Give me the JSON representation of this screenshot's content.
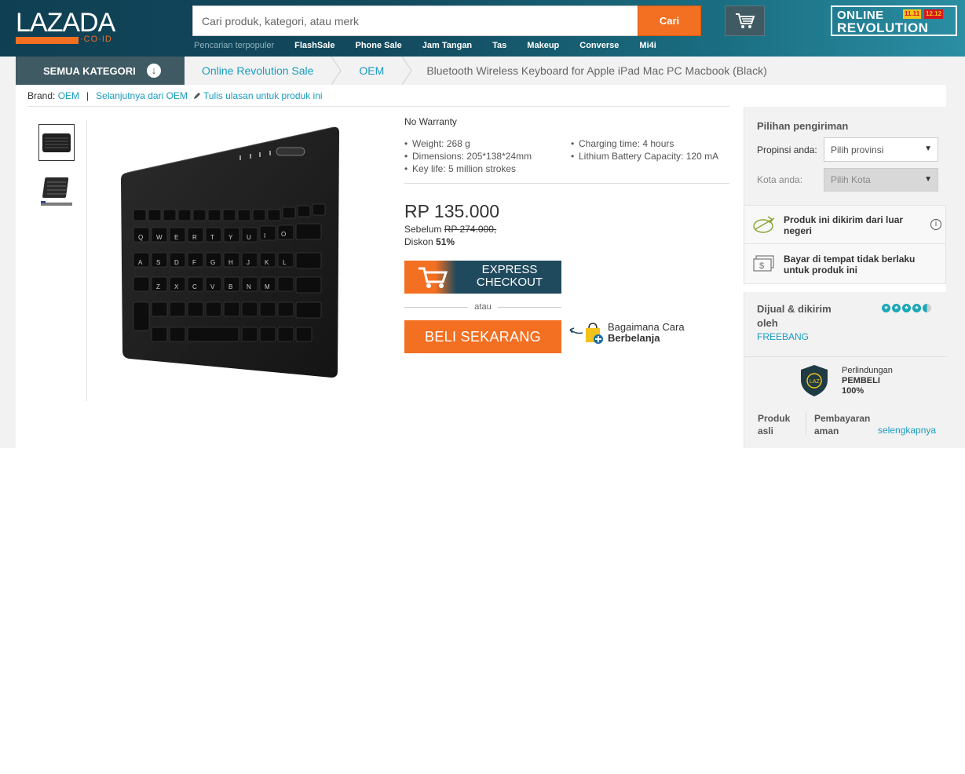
{
  "header": {
    "logo_text": "LAZADA",
    "logo_sub": "·CO·ID",
    "search_placeholder": "Cari produk, kategori, atau merk",
    "search_button": "Cari",
    "popular_label": "Pencarian terpopuler",
    "popular_links": [
      "FlashSale",
      "Phone Sale",
      "Jam Tangan",
      "Tas",
      "Makeup",
      "Converse",
      "Mi4i"
    ],
    "promo_line1": "ONLINE",
    "promo_line2": "REVOLUTION",
    "promo_badge1": "11.11",
    "promo_badge2": "12.12"
  },
  "nav": {
    "all_categories": "SEMUA KATEGORI",
    "breadcrumbs": [
      "Online Revolution Sale",
      "OEM"
    ],
    "current": "Bluetooth Wireless Keyboard for Apple iPad Mac PC Macbook (Black)"
  },
  "brand_row": {
    "brand_label": "Brand:",
    "brand_link": "OEM",
    "separator": "|",
    "more_from": "Selanjutnya dari OEM",
    "write_review": "Tulis ulasan untuk produk ini"
  },
  "product": {
    "warranty": "No Warranty",
    "specs": [
      "Weight: 268 g",
      "Charging time: 4 hours",
      "Dimensions: 205*138*24mm",
      "Lithium Battery Capacity: 120 mA",
      "Key life: 5 million strokes"
    ],
    "price": "RP 135.000",
    "before_label": "Sebelum",
    "before_price": "RP 274.000,",
    "discount_label": "Diskon",
    "discount_value": "51%",
    "express_line1": "EXPRESS",
    "express_line2": "CHECKOUT",
    "or_text": "atau",
    "buy_now": "BELI SEKARANG",
    "how_to_line1": "Bagaimana Cara",
    "how_to_line2": "Berbelanja"
  },
  "shipping": {
    "title": "Pilihan pengiriman",
    "province_label": "Propinsi anda:",
    "province_value": "Pilih provinsi",
    "city_label": "Kota anda:",
    "city_value": "Pilih Kota",
    "overseas_text": "Produk ini dikirim dari luar negeri",
    "cod_text": "Bayar di tempat tidak berlaku untuk produk ini"
  },
  "seller": {
    "title": "Dijual & dikirim oleh",
    "name": "FREEBANG",
    "rating": 4.5,
    "protection_line1": "Perlindungan",
    "protection_line2": "PEMBELI",
    "protection_line3": "100%",
    "feature1": "Produk asli",
    "feature2": "Pembayaran aman",
    "more": "selengkapnya"
  },
  "colors": {
    "accent": "#f36f21",
    "header_dark": "#0f3f53",
    "link": "#1a9cc0",
    "nav_dark": "#3f5a63"
  }
}
